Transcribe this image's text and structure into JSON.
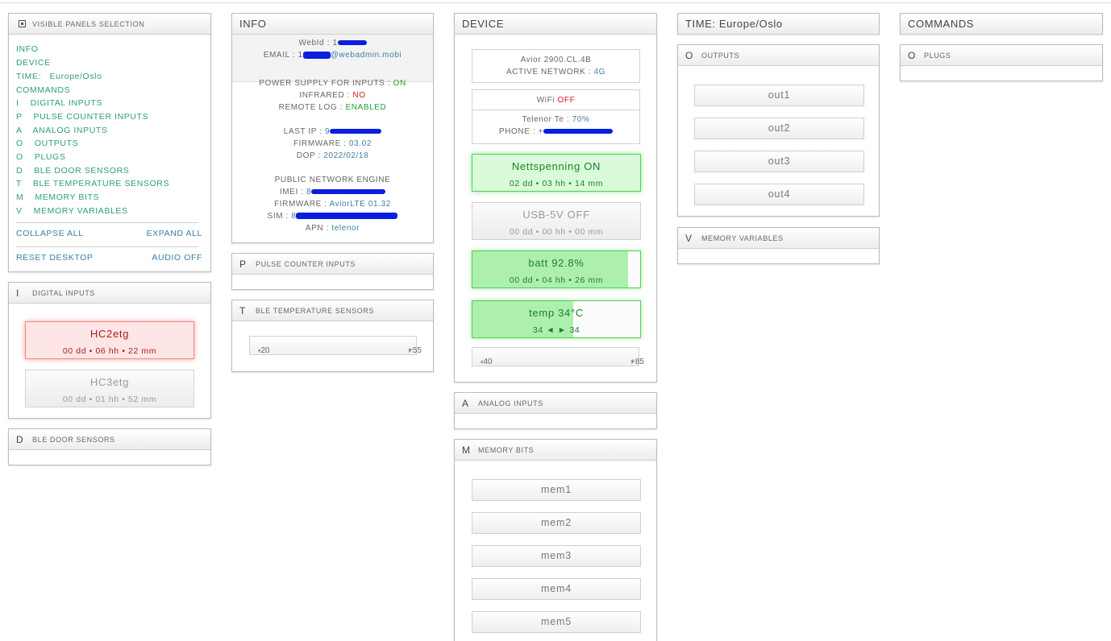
{
  "visible": {
    "header": "VISIBLE PANELS SELECTION",
    "items": [
      "INFO",
      "DEVICE",
      "TIME:   Europe/Oslo",
      "COMMANDS",
      "I    DIGITAL INPUTS",
      "P    PULSE COUNTER INPUTS",
      "A    ANALOG INPUTS",
      "O    OUTPUTS",
      "O    PLUGS",
      "D    BLE DOOR SENSORS",
      "T    BLE TEMPERATURE SENSORS",
      "M    MEMORY BITS",
      "V    MEMORY VARIABLES"
    ],
    "collapse": "COLLAPSE ALL",
    "expand": "EXPAND ALL",
    "reset": "RESET DESKTOP",
    "audio": "AUDIO OFF"
  },
  "digital": {
    "letter": "I",
    "title": "DIGITAL INPUTS",
    "tiles": [
      {
        "name": "HC2etg",
        "time": "00 dd • 06 hh • 22 mm"
      },
      {
        "name": "HC3etg",
        "time": "00 dd • 01 hh • 52 mm"
      }
    ]
  },
  "door": {
    "letter": "D",
    "title": "BLE DOOR SENSORS"
  },
  "info": {
    "title": "INFO",
    "webid_label": "WebId : ",
    "webid_value": "1",
    "email_label": "EMAIL : ",
    "email_value_a": "1",
    "email_value_b": "@webadmin.mobi",
    "power_label": "POWER SUPPLY FOR INPUTS : ",
    "power_value": "ON",
    "ir_label": "INFRARED : ",
    "ir_value": "NO",
    "remote_label": "REMOTE LOG : ",
    "remote_value": "ENABLED",
    "lastip_label": "LAST IP : ",
    "lastip_value": "9",
    "fw_label": "FIRMWARE : ",
    "fw_value": "03.02",
    "dop_label": "DOP : ",
    "dop_value": "2022/02/18",
    "pne": "PUBLIC NETWORK ENGINE",
    "imei_label": "IMEI : ",
    "imei_value": "8",
    "fw2_label": "FIRMWARE : ",
    "fw2_value": "AviorLTE 01.32",
    "sim_label": "SIM : ",
    "sim_value": "8",
    "apn_label": "APN : ",
    "apn_value": "telenor"
  },
  "pulse": {
    "letter": "P",
    "title": "PULSE COUNTER INPUTS"
  },
  "bletemp": {
    "letter": "T",
    "title": "BLE TEMPERATURE SENSORS",
    "min": "-20",
    "max": "+55"
  },
  "device": {
    "title": "DEVICE",
    "model": "Avior 2900.CL.4B",
    "net_label": "ACTIVE NETWORK : ",
    "net_value": "4G",
    "wifi_label": "WiFi ",
    "wifi_value": "OFF",
    "carrier_label": "Telenor Te : ",
    "carrier_value": "70%",
    "phone_label": "PHONE : ",
    "phone_value": "+",
    "tiles": [
      {
        "name": "Nettspenning ON",
        "time": "02 dd • 03 hh • 14 mm"
      },
      {
        "name": "USB-5V OFF",
        "time": "00 dd • 00 hh • 00 mm"
      },
      {
        "name": "batt 92.8%",
        "time": "00 dd • 04 hh • 26 mm",
        "level": 0.928
      },
      {
        "name": "temp 34°C",
        "time": "34 ◄ ► 34",
        "level": 0.6
      }
    ],
    "range_min": "-40",
    "range_max": "+85"
  },
  "analog": {
    "letter": "A",
    "title": "ANALOG INPUTS"
  },
  "membits": {
    "letter": "M",
    "title": "MEMORY BITS",
    "items": [
      "mem1",
      "mem2",
      "mem3",
      "mem4",
      "mem5"
    ]
  },
  "time": {
    "title": "TIME: Europe/Oslo"
  },
  "outputs": {
    "letter": "O",
    "title": "OUTPUTS",
    "items": [
      "out1",
      "out2",
      "out3",
      "out4"
    ]
  },
  "memvars": {
    "letter": "V",
    "title": "MEMORY VARIABLES"
  },
  "commands": {
    "title": "COMMANDS"
  },
  "plugs": {
    "letter": "O",
    "title": "PLUGS"
  }
}
